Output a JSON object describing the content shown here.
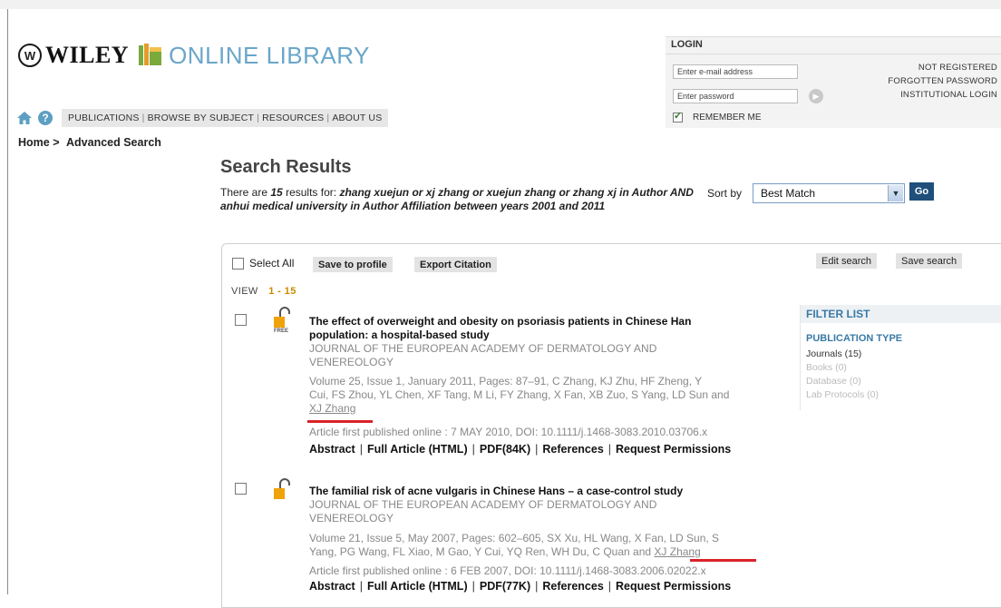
{
  "header": {
    "brand_wiley": "WILEY",
    "brand_seal": "W",
    "brand_online": "ONLINE LIBRARY",
    "nav": [
      "PUBLICATIONS",
      "BROWSE BY SUBJECT",
      "RESOURCES",
      "ABOUT US"
    ]
  },
  "login": {
    "title": "LOGIN",
    "email_placeholder": "Enter e-mail address",
    "password_placeholder": "Enter password",
    "remember_label": "REMEMBER ME",
    "remember_checked": true,
    "links": [
      "NOT REGISTERED",
      "FORGOTTEN PASSWORD",
      "INSTITUTIONAL LOGIN"
    ]
  },
  "breadcrumb": {
    "home": "Home >",
    "current": "Advanced Search"
  },
  "results": {
    "title": "Search Results",
    "summary_prefix": "There are",
    "count": "15",
    "summary_mid": "results for:",
    "query": "zhang xuejun or xj zhang or xuejun zhang or zhang xj in Author AND anhui medical university in Author Affiliation between years 2001 and 2011",
    "sort_label": "Sort by",
    "sort_value": "Best Match",
    "go_label": "Go"
  },
  "toolbar": {
    "select_all": "Select All",
    "save_to_profile": "Save to profile",
    "export_citation": "Export Citation",
    "edit_search": "Edit search",
    "save_search": "Save search",
    "view_label": "VIEW",
    "view_range": "1 - 15"
  },
  "filter": {
    "title": "FILTER LIST",
    "section": "PUBLICATION TYPE",
    "items": [
      {
        "label": "Journals (15)",
        "enabled": true
      },
      {
        "label": "Books (0)",
        "enabled": false
      },
      {
        "label": "Database (0)",
        "enabled": false
      },
      {
        "label": "Lab Protocols (0)",
        "enabled": false
      }
    ]
  },
  "articles": [
    {
      "free_badge": "FREE",
      "title_line1": "The effect of overweight and obesity on psoriasis patients in Chinese Han",
      "title_line2": "population: a hospital-based study",
      "journal_line1": "JOURNAL OF THE EUROPEAN ACADEMY OF DERMATOLOGY AND",
      "journal_line2": "VENEREOLOGY",
      "vol_line1": "Volume 25, Issue 1, January 2011, Pages: 87–91, C Zhang, KJ Zhu, HF Zheng, Y",
      "vol_line2": "Cui, FS Zhou, YL Chen, XF Tang, M Li, FY Zhang, X Fan, XB Zuo, S Yang, LD Sun and",
      "vol_line3": "XJ Zhang",
      "published": "Article first published online : 7 MAY 2010, DOI: 10.1111/j.1468-3083.2010.03706.x",
      "links": [
        "Abstract",
        "Full Article (HTML)",
        "PDF(84K)",
        "References",
        "Request Permissions"
      ]
    },
    {
      "title_line1": "The familial risk of acne vulgaris in Chinese Hans – a case-control study",
      "journal_line1": "JOURNAL OF THE EUROPEAN ACADEMY OF DERMATOLOGY AND",
      "journal_line2": "VENEREOLOGY",
      "vol_line1": "Volume 21, Issue 5, May 2007, Pages: 602–605, SX Xu, HL Wang, X Fan, LD Sun, S",
      "vol_line2a": "Yang, PG Wang, FL Xiao, M Gao, Y Cui, YQ Ren, WH Du, C Quan and ",
      "vol_line2b": "XJ Zhang",
      "published": "Article first published online : 6 FEB 2007, DOI: 10.1111/j.1468-3083.2006.02022.x",
      "links": [
        "Abstract",
        "Full Article (HTML)",
        "PDF(77K)",
        "References",
        "Request Permissions"
      ]
    }
  ],
  "colors": {
    "brand_blue": "#6aa6c9",
    "go_button": "#1f4f7a",
    "filter_blue": "#3a7aa6",
    "view_range": "#c88a00",
    "annotation_red": "#d8232a"
  }
}
